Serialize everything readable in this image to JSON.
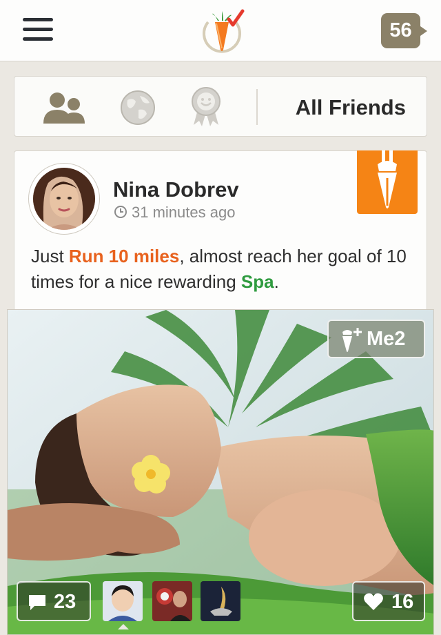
{
  "header": {
    "notification_count": "56",
    "brand_color": "#f58415",
    "icons": [
      "menu-icon",
      "carrot-logo",
      "notification-badge"
    ]
  },
  "filter": {
    "label": "All Friends",
    "icons": [
      "friends-icon",
      "globe-icon",
      "award-icon"
    ]
  },
  "post": {
    "author": "Nina Dobrev",
    "time": "31 minutes ago",
    "text_parts": {
      "p1": "Just ",
      "activity": "Run 10 miles",
      "p2": ", almost reach her goal of 10 times for a nice rewarding ",
      "reward": "Spa",
      "p3": "."
    },
    "category_icon": "carrot-brush-icon",
    "me2_label": "Me2",
    "comment_count": "23",
    "like_count": "16",
    "accent_orange": "#e8621e",
    "accent_green": "#2f9b3f"
  }
}
